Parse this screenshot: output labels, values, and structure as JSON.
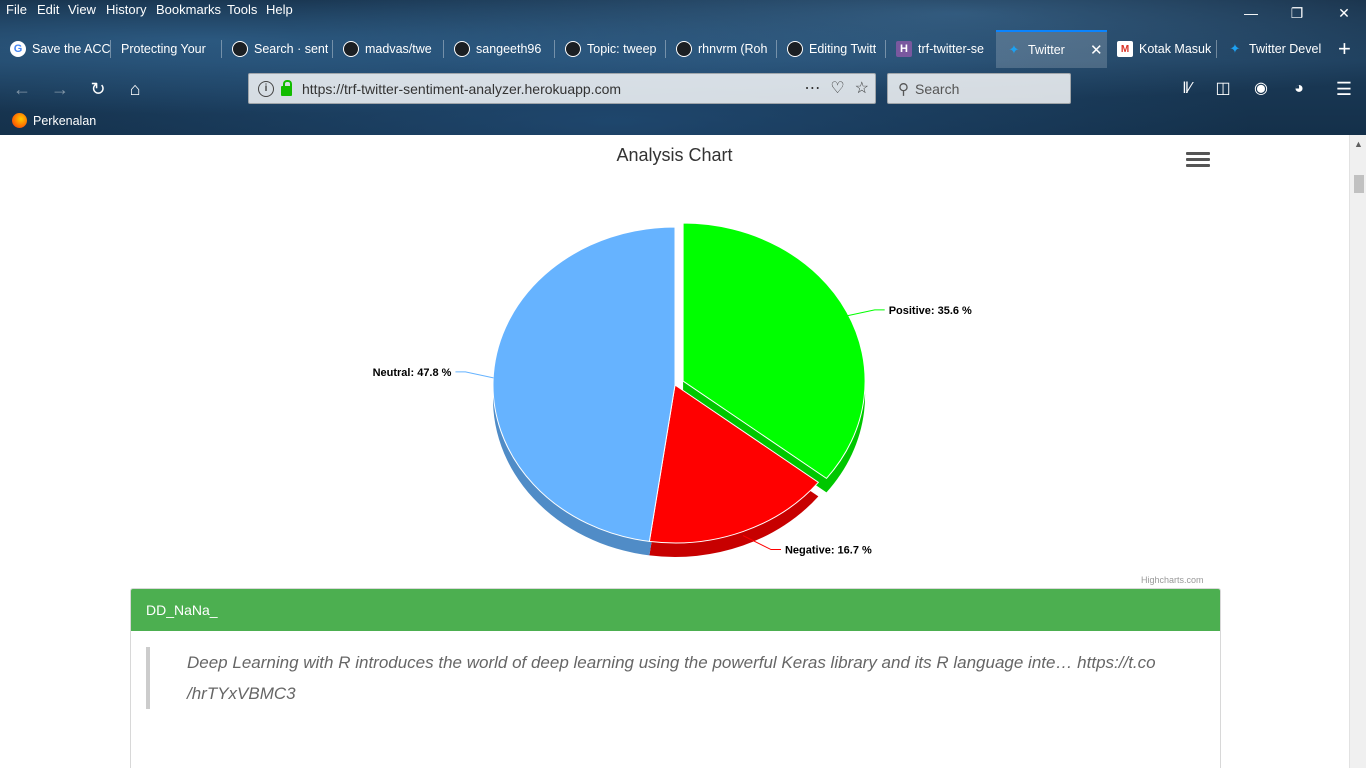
{
  "menu": [
    "File",
    "Edit",
    "View",
    "History",
    "Bookmarks",
    "Tools",
    "Help"
  ],
  "tabs": [
    {
      "label": "Save the ACC",
      "icon": "google-icon"
    },
    {
      "label": "Protecting Your",
      "icon": ""
    },
    {
      "label": "Search · sent",
      "icon": "github-icon"
    },
    {
      "label": "madvas/twe",
      "icon": "github-icon"
    },
    {
      "label": "sangeeth96",
      "icon": "github-icon"
    },
    {
      "label": "Topic: tweep",
      "icon": "github-icon"
    },
    {
      "label": "rhnvrm (Roh",
      "icon": "github-icon"
    },
    {
      "label": "Editing Twitt",
      "icon": "github-icon"
    },
    {
      "label": "trf-twitter-se",
      "icon": "heroku-icon"
    },
    {
      "label": "Twitter",
      "icon": "twitter-icon"
    },
    {
      "label": "Kotak Masuk",
      "icon": "gmail-icon"
    },
    {
      "label": "Twitter Devel",
      "icon": "twitter-icon"
    }
  ],
  "address": {
    "url": "https://trf-twitter-sentiment-analyzer.herokuapp.com",
    "search_placeholder": "Search"
  },
  "bookmarks": [
    {
      "label": "Perkenalan",
      "icon": "firefox-icon"
    }
  ],
  "chart_data": {
    "type": "pie",
    "title": "Analysis Chart",
    "slices": [
      {
        "name": "Positive",
        "value": 35.6,
        "label": "Positive: 35.6 %",
        "color": "#00ff00",
        "sliced": true
      },
      {
        "name": "Negative",
        "value": 16.7,
        "label": "Negative: 16.7 %",
        "color": "#ff0000",
        "sliced": false
      },
      {
        "name": "Neutral",
        "value": 47.8,
        "label": "Neutral: 47.8 %",
        "color": "#66b3ff",
        "sliced": false
      }
    ],
    "credits": "Highcharts.com"
  },
  "tweet": {
    "user": "DD_NaNa_",
    "text": "Deep Learning with R introduces the world of deep learning using the powerful Keras library and its R language inte… https://t.co /hrTYxVBMC3"
  }
}
